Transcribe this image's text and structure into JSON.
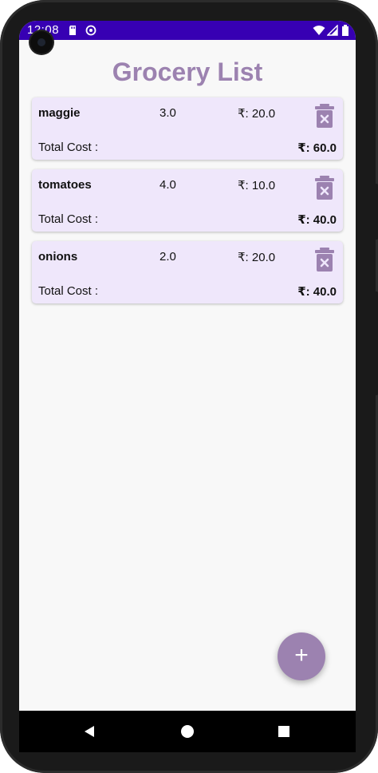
{
  "status_bar": {
    "time": "12:08",
    "background": "#3700b3",
    "icons": [
      "sd-card-icon",
      "sync-icon",
      "wifi-icon",
      "signal-icon",
      "battery-icon"
    ]
  },
  "app": {
    "title": "Grocery List",
    "accent": "#9c82b0",
    "card_background": "#efe7fb"
  },
  "items": [
    {
      "name": "maggie",
      "quantity": "3.0",
      "price": "₹: 20.0",
      "total_label": "Total Cost :",
      "total": "₹: 60.0"
    },
    {
      "name": "tomatoes",
      "quantity": "4.0",
      "price": "₹: 10.0",
      "total_label": "Total Cost :",
      "total": "₹: 40.0"
    },
    {
      "name": "onions",
      "quantity": "2.0",
      "price": "₹: 20.0",
      "total_label": "Total Cost :",
      "total": "₹: 40.0"
    }
  ],
  "fab": {
    "label": "+",
    "icon": "add-icon"
  },
  "nav_bar": {
    "buttons": [
      "back-icon",
      "home-icon",
      "recents-icon"
    ]
  }
}
